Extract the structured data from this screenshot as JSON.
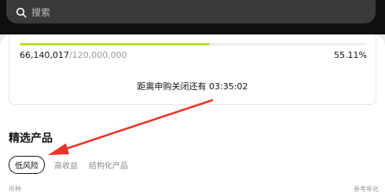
{
  "search": {
    "placeholder": "搜索",
    "icon": "search-icon"
  },
  "subscription": {
    "raised": "66,140,017",
    "goal": "120,000,000",
    "percent_text": "55.11%",
    "progress": 0.5511,
    "countdown": "距离申购关闭还有 03:35:02"
  },
  "featured": {
    "title": "精选产品",
    "tabs": [
      {
        "label": "低风险",
        "active": true
      },
      {
        "label": "高收益",
        "active": false
      },
      {
        "label": "结构化产品",
        "active": false
      }
    ],
    "columns": {
      "left": "币种",
      "right": "参考年化"
    }
  },
  "colors": {
    "progress_fill": "#b6e22a",
    "annotation_arrow": "#e8342c"
  }
}
